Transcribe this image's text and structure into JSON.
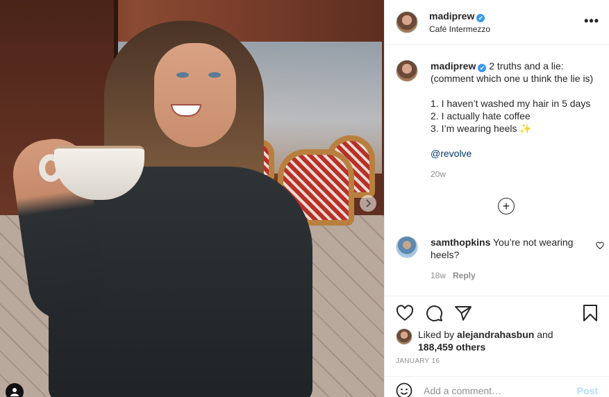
{
  "photo": {
    "alt_icons": [
      "chevron-right-icon",
      "user-tag-icon"
    ]
  },
  "header": {
    "username": "madiprew",
    "verified": "✔",
    "location": "Café Intermezzo",
    "more": "•••"
  },
  "caption": {
    "username": "madiprew",
    "verified": "✔",
    "line1": "2 truths and a lie:",
    "line2": "(comment which one u think the lie is)",
    "item1": "1. I haven’t washed my hair in 5 days",
    "item2": "2. I actually hate coffee",
    "item3": "3. I’m wearing heels ✨",
    "mention": "@revolve",
    "age": "20w"
  },
  "comment": {
    "username": "samthopkins",
    "text": "You’re not wearing heels?",
    "age": "18w",
    "reply_label": "Reply"
  },
  "load_more": "+",
  "likes": {
    "prefix": "Liked by",
    "liker": "alejandrahasbun",
    "and": "and",
    "others": "188,459 others"
  },
  "date": "JANUARY 16",
  "add_comment": {
    "placeholder": "Add a comment…",
    "post_label": "Post"
  },
  "colors": {
    "link": "#00376b",
    "verified": "#3897f0",
    "post_disabled": "#b2dffc",
    "muted": "#8e8e8e"
  }
}
